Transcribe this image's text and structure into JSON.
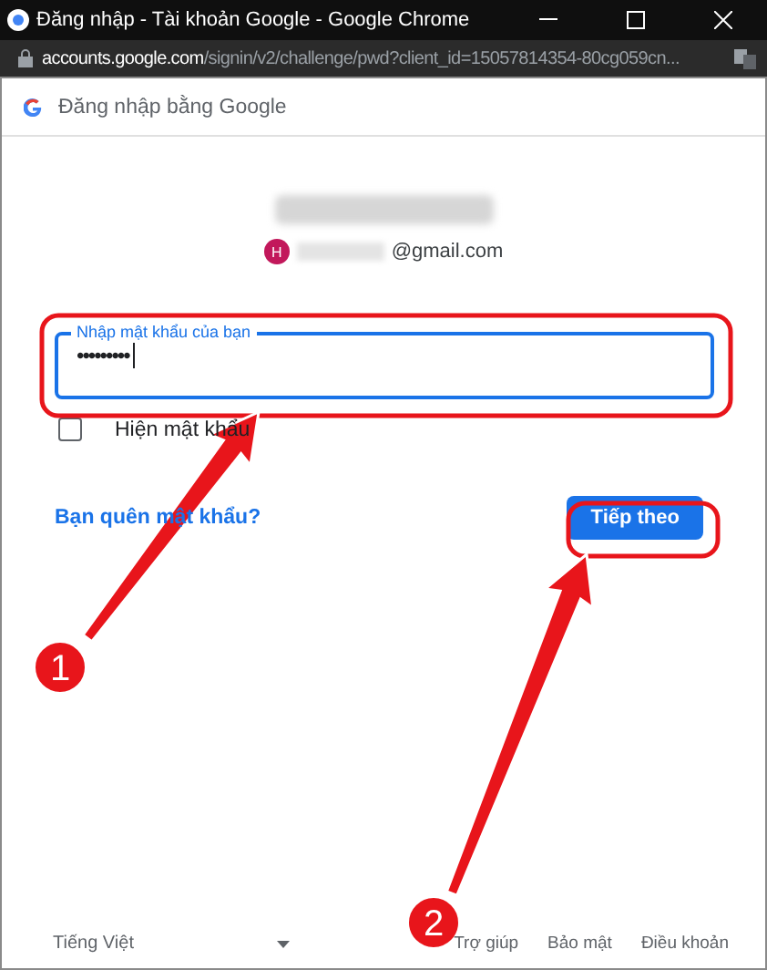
{
  "window": {
    "title": "Đăng nhập - Tài khoản Google - Google Chrome"
  },
  "address_bar": {
    "host": "accounts.google.com",
    "path": "/signin/v2/challenge/pwd?client_id=15057814354-80cg059cn..."
  },
  "page_header": {
    "title": "Đăng nhập bằng Google"
  },
  "account": {
    "avatar_letter": "H",
    "email_suffix": "@gmail.com"
  },
  "password_field": {
    "label": "Nhập mật khẩu của bạn",
    "value": "•••••••••",
    "focused": true
  },
  "show_password": {
    "label": "Hiện mật khẩu",
    "checked": false
  },
  "forgot_link": "Bạn quên mật khẩu?",
  "next_button": "Tiếp theo",
  "footer": {
    "language": "Tiếng Việt",
    "links": [
      "Trợ giúp",
      "Bảo mật",
      "Điều khoản"
    ]
  },
  "annotations": [
    {
      "number": "1"
    },
    {
      "number": "2"
    }
  ]
}
